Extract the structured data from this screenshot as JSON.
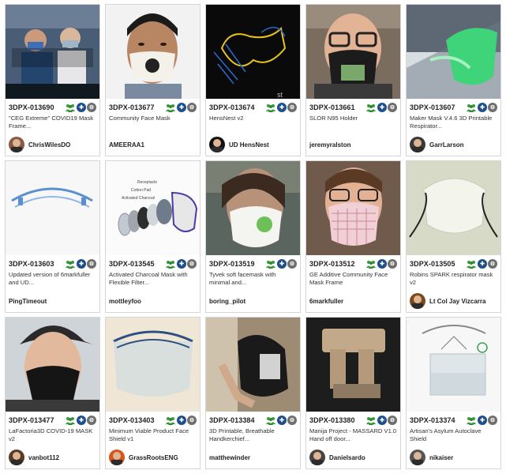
{
  "cards": [
    {
      "id": "3DPX-013690",
      "title": "\"CEG Extreme\" COVID19 Mask Frame...",
      "author": "ChrisWilesDO",
      "avatar": true,
      "thumb": "video-team",
      "avatar_color": "#8a5a44"
    },
    {
      "id": "3DPX-013677",
      "title": "Community Face Mask",
      "author": "AMEERAA1",
      "avatar": false,
      "thumb": "face-white-mask"
    },
    {
      "id": "3DPX-013674",
      "title": "HensNest v2",
      "author": "UD HensNest",
      "avatar": true,
      "thumb": "wireframe",
      "avatar_color": "#111111"
    },
    {
      "id": "3DPX-013661",
      "title": "SLOR N95 Holder",
      "author": "jeremyralston",
      "avatar": false,
      "thumb": "face-black-mask"
    },
    {
      "id": "3DPX-013607",
      "title": "Maker Mask V.4.6 3D Printable Respirator...",
      "author": "GarrLarson",
      "avatar": true,
      "thumb": "green-render",
      "avatar_color": "#3a3a3a"
    },
    {
      "id": "3DPX-013603",
      "title": "Updated version of 6markfuller and UD...",
      "author": "PingTimeout",
      "avatar": false,
      "thumb": "blue-shield"
    },
    {
      "id": "3DPX-013545",
      "title": "Activated Charcoal Mask with Flexible Filter...",
      "author": "mottleyfoo",
      "avatar": false,
      "thumb": "exploded"
    },
    {
      "id": "3DPX-013519",
      "title": "Tyvek soft facemask with minimal and...",
      "author": "boring_pilot",
      "avatar": false,
      "thumb": "tyvek"
    },
    {
      "id": "3DPX-013512",
      "title": "GE Additive Community Face Mask Frame",
      "author": "6markfuller",
      "avatar": false,
      "thumb": "pink-mask"
    },
    {
      "id": "3DPX-013505",
      "title": "Robins SPARK respirator mask v2",
      "author": "Lt Col Jay Vizcarra",
      "avatar": true,
      "thumb": "spark",
      "avatar_color": "#7a4a1c"
    },
    {
      "id": "3DPX-013477",
      "title": "LaFactoria3D COVID-19 MASK v2",
      "author": "vanbot112",
      "avatar": true,
      "thumb": "cap-mask",
      "avatar_color": "#5a3a22"
    },
    {
      "id": "3DPX-013403",
      "title": "Minimum Viable Product Face Shield v1",
      "author": "GrassRootsENG",
      "avatar": true,
      "thumb": "face-shield",
      "avatar_color": "#d4561a"
    },
    {
      "id": "3DPX-013384",
      "title": "3D Printable, Breathable Handkerchief...",
      "author": "matthewinder",
      "avatar": false,
      "thumb": "black-printed"
    },
    {
      "id": "3DPX-013380",
      "title": "Manija Project - MASSARD V1.0 Hand off door...",
      "author": "Danielsardo",
      "avatar": true,
      "thumb": "door-handle",
      "avatar_color": "#444444"
    },
    {
      "id": "3DPX-013374",
      "title": "Artisan's Asylum Autoclave Shield",
      "author": "nikaiser",
      "avatar": true,
      "thumb": "autoclave",
      "avatar_color": "#555555"
    }
  ],
  "icons": {
    "community": "community-icon",
    "clinical": "clinical-use-icon",
    "review": "review-status-icon"
  },
  "colors": {
    "clinical_badge": "#1f4f8a",
    "review_badge": "#6e6e6e",
    "community_badge": "#3a9a3a"
  }
}
